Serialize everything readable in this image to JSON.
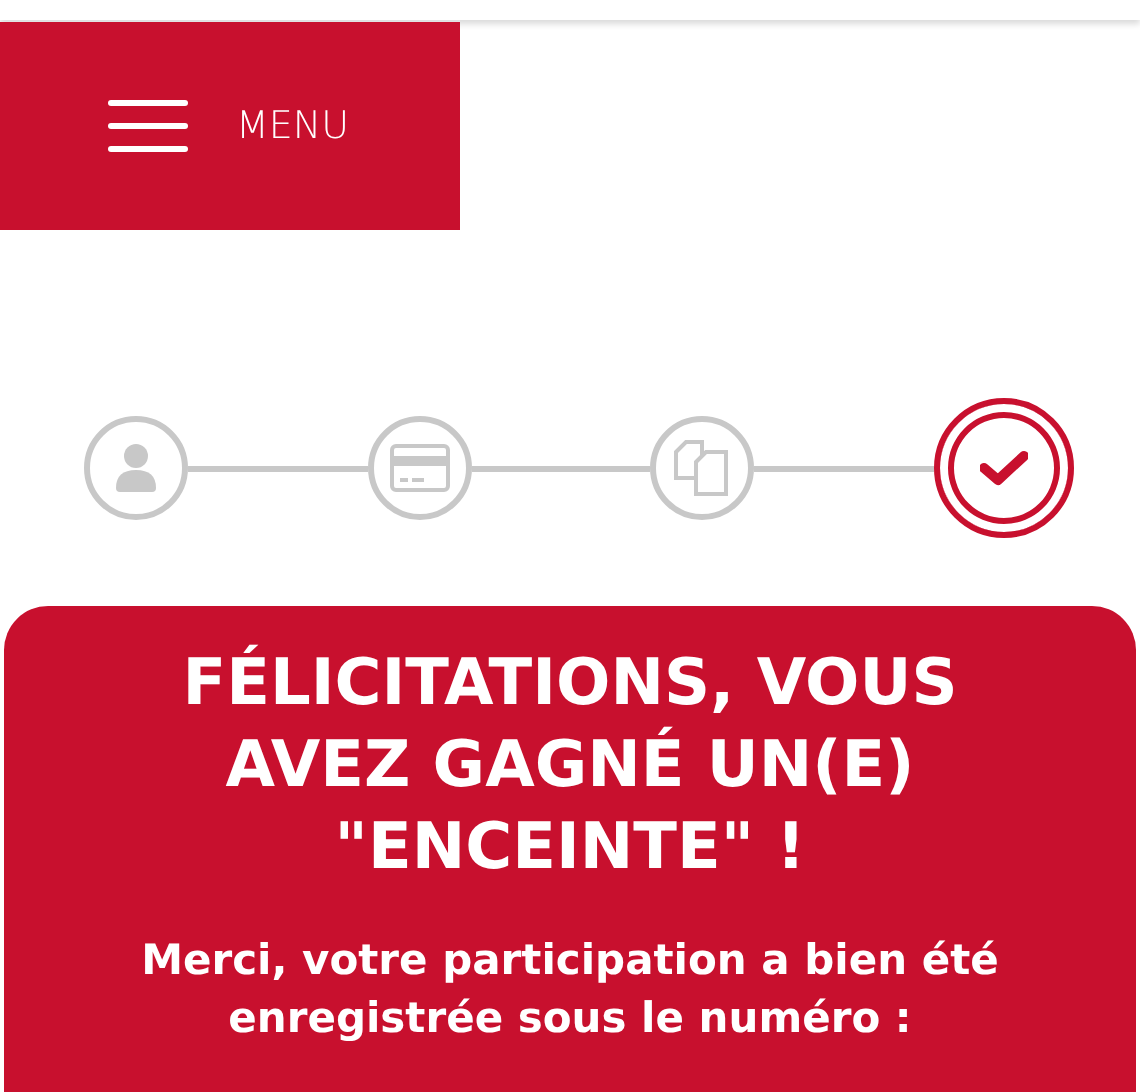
{
  "menu_button": {
    "label": "MENU"
  },
  "steps": [
    {
      "kind": "user",
      "selected": false
    },
    {
      "kind": "card",
      "selected": false
    },
    {
      "kind": "documents",
      "selected": false
    },
    {
      "kind": "check",
      "selected": true
    }
  ],
  "result_card": {
    "title": "FÉLICITATIONS, VOUS AVEZ GAGNÉ UN(E) \"ENCEINTE\" !",
    "message": "Merci, votre participation a bien été enregistrée sous le numéro :"
  }
}
